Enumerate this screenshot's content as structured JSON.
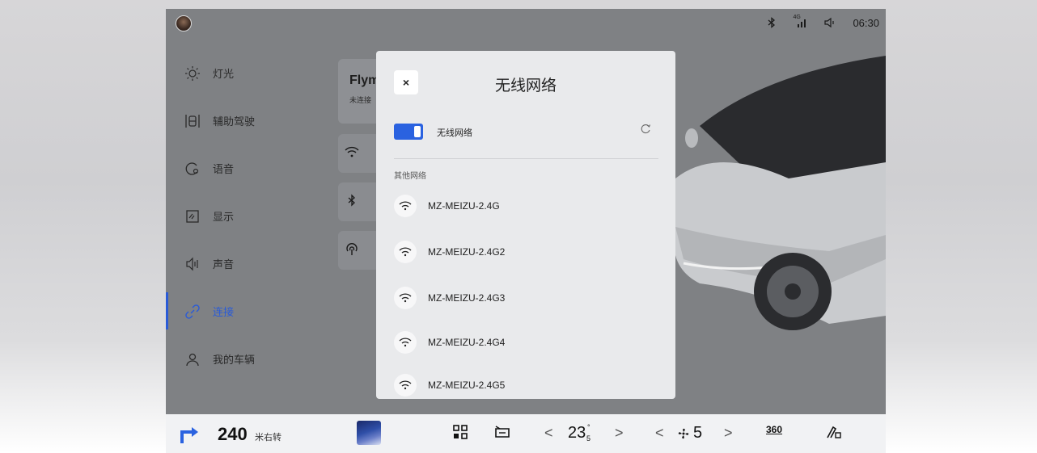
{
  "status_bar": {
    "signal_label": "4G",
    "time": "06:30",
    "icons": [
      "bluetooth-icon",
      "signal-icon",
      "volume-icon"
    ]
  },
  "menu": {
    "items": [
      {
        "label": "灯光",
        "icon": "light-icon"
      },
      {
        "label": "辅助驾驶",
        "icon": "driving-assist-icon"
      },
      {
        "label": "语音",
        "icon": "voice-icon"
      },
      {
        "label": "显示",
        "icon": "display-icon"
      },
      {
        "label": "声音",
        "icon": "sound-icon"
      },
      {
        "label": "连接",
        "icon": "link-icon",
        "active": true
      },
      {
        "label": "我的车辆",
        "icon": "user-icon"
      }
    ]
  },
  "flyme_card": {
    "title": "Flym",
    "subtitle": "未连接"
  },
  "dialog": {
    "close_label": "×",
    "title": "无线网络",
    "toggle_label": "无线网络",
    "toggle_on": true,
    "section_label": "其他网络",
    "networks": [
      "MZ-MEIZU-2.4G",
      "MZ-MEIZU-2.4G2",
      "MZ-MEIZU-2.4G3",
      "MZ-MEIZU-2.4G4",
      "MZ-MEIZU-2.4G5"
    ]
  },
  "bottom_bar": {
    "distance": "240",
    "distance_unit": "米右转",
    "temperature": "23",
    "temperature_decimal": "5",
    "temperature_degree": "°",
    "fan_level": "5",
    "prev_chevron": "<",
    "next_chevron": ">",
    "view_360": "360"
  },
  "colors": {
    "accent": "#2a62e0",
    "active_menu": "#2a5bd7"
  }
}
